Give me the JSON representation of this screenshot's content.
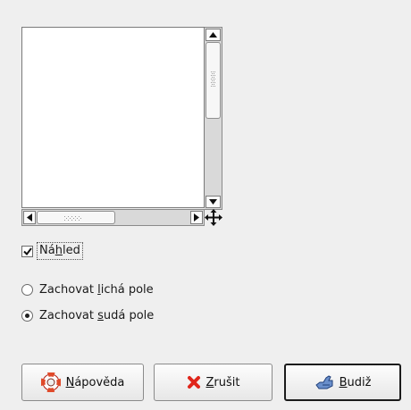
{
  "preview": {
    "checkbox_label_pre": "Ná",
    "checkbox_label_key": "h",
    "checkbox_label_post": "led",
    "checked": true
  },
  "fields": {
    "options": [
      {
        "pre": "Zachovat ",
        "key": "l",
        "post": "ichá pole",
        "selected": false
      },
      {
        "pre": "Zachovat ",
        "key": "s",
        "post": "udá pole",
        "selected": true
      }
    ]
  },
  "buttons": {
    "help": {
      "key": "N",
      "rest": "ápověda",
      "icon": "lifebuoy-icon"
    },
    "cancel": {
      "key": "Z",
      "rest": "rušit",
      "icon": "red-x-icon"
    },
    "ok": {
      "key": "B",
      "rest": "udiž",
      "icon": "ok-hand-icon"
    }
  },
  "colors": {
    "background": "#efefef",
    "cancel_icon": "#e0261b",
    "help_icon": "#e04a2a"
  }
}
